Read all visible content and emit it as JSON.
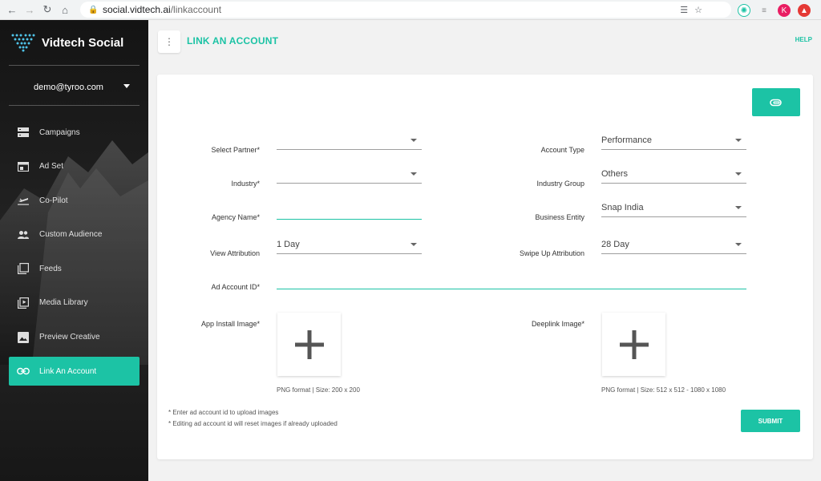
{
  "browser": {
    "url_host": "social.vidtech.ai",
    "url_path": "/linkaccount",
    "profile_initial": "K"
  },
  "sidebar": {
    "brand": "Vidtech Social",
    "user_email": "demo@tyroo.com",
    "items": [
      {
        "label": "Campaigns",
        "icon": "campaigns-icon",
        "active": false
      },
      {
        "label": "Ad Set",
        "icon": "ad-set-icon",
        "active": false
      },
      {
        "label": "Co-Pilot",
        "icon": "plane-icon",
        "active": false
      },
      {
        "label": "Custom Audience",
        "icon": "people-icon",
        "active": false
      },
      {
        "label": "Feeds",
        "icon": "feeds-icon",
        "active": false
      },
      {
        "label": "Media Library",
        "icon": "media-library-icon",
        "active": false
      },
      {
        "label": "Preview Creative",
        "icon": "image-icon",
        "active": false
      },
      {
        "label": "Link An Account",
        "icon": "link-icon",
        "active": true
      }
    ]
  },
  "header": {
    "title": "LINK AN ACCOUNT",
    "help": "HELP"
  },
  "form": {
    "select_partner": {
      "label": "Select Partner",
      "required": "*",
      "value": ""
    },
    "industry": {
      "label": "Industry",
      "required": "*",
      "value": ""
    },
    "agency_name": {
      "label": "Agency Name",
      "required": "*",
      "value": ""
    },
    "view_attribution": {
      "label": "View Attribution",
      "value": "1 Day"
    },
    "account_type": {
      "label": "Account Type",
      "value": "Performance"
    },
    "industry_group": {
      "label": "Industry Group",
      "value": "Others"
    },
    "business_entity": {
      "label": "Business Entity",
      "value": "Snap India"
    },
    "swipe_up_attribution": {
      "label": "Swipe Up Attribution",
      "value": "28 Day"
    },
    "ad_account_id": {
      "label": "Ad Account ID",
      "required": "*",
      "value": ""
    },
    "app_install_image": {
      "label": "App Install Image",
      "required": "*",
      "hint": "PNG format | Size: 200 x 200"
    },
    "deeplink_image": {
      "label": "Deeplink Image",
      "required": "*",
      "hint": "PNG format | Size: 512 x 512 - 1080 x 1080"
    },
    "notes": [
      "* Enter ad account id to upload images",
      "* Editing ad account id will reset images if already uploaded"
    ],
    "submit": "SUBMIT"
  },
  "colors": {
    "accent": "#1cc3a5",
    "sidebar_bg": "#1d1d1d",
    "page_bg": "#f2f2f2"
  }
}
